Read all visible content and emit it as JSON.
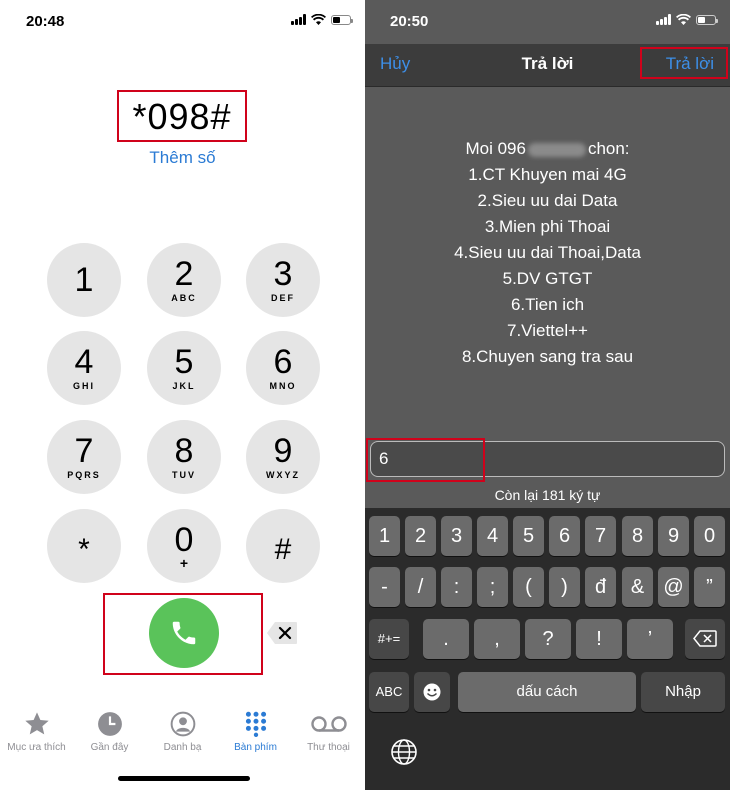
{
  "left": {
    "status_time": "20:48",
    "number": "*098#",
    "add_number": "Thêm số",
    "keys": [
      {
        "digit": "1",
        "letters": ""
      },
      {
        "digit": "2",
        "letters": "ABC"
      },
      {
        "digit": "3",
        "letters": "DEF"
      },
      {
        "digit": "4",
        "letters": "GHI"
      },
      {
        "digit": "5",
        "letters": "JKL"
      },
      {
        "digit": "6",
        "letters": "MNO"
      },
      {
        "digit": "7",
        "letters": "PQRS"
      },
      {
        "digit": "8",
        "letters": "TUV"
      },
      {
        "digit": "9",
        "letters": "WXYZ"
      },
      {
        "digit": "*",
        "letters": ""
      },
      {
        "digit": "0",
        "letters": "+"
      },
      {
        "digit": "#",
        "letters": ""
      }
    ],
    "tabs": [
      {
        "label": "Mục ưa thích",
        "icon": "star-icon"
      },
      {
        "label": "Gần đây",
        "icon": "clock-icon"
      },
      {
        "label": "Danh bạ",
        "icon": "contact-icon"
      },
      {
        "label": "Bàn phím",
        "icon": "keypad-icon",
        "active": true
      },
      {
        "label": "Thư thoại",
        "icon": "voicemail-icon"
      }
    ],
    "accent_color": "#2b7bd4",
    "call_color": "#5ac35a"
  },
  "right": {
    "status_time": "20:50",
    "nav": {
      "cancel": "Hủy",
      "title": "Trả lời",
      "reply": "Trả lời"
    },
    "message": {
      "line1_prefix": "Moi 096",
      "line1_suffix": "chon:",
      "options": [
        "1.CT Khuyen mai 4G",
        "2.Sieu uu dai Data",
        "3.Mien phi Thoai",
        "4.Sieu uu dai Thoai,Data",
        "5.DV GTGT",
        "6.Tien ich",
        "7.Viettel++",
        "8.Chuyen sang tra sau"
      ]
    },
    "input_value": "6",
    "remaining": "Còn lại 181 ký tự",
    "keyboard": {
      "row1": [
        "1",
        "2",
        "3",
        "4",
        "5",
        "6",
        "7",
        "8",
        "9",
        "0"
      ],
      "row2": [
        "-",
        "/",
        ":",
        ";",
        "(",
        ")",
        "đ",
        "&",
        "@",
        "”"
      ],
      "row3": [
        ".",
        ",",
        "?",
        "!",
        "’"
      ],
      "symbols_key": "#+=",
      "abc_key": "ABC",
      "space_key": "dấu cách",
      "return_key": "Nhập"
    },
    "accent_color": "#3d8fe8"
  },
  "highlight_color": "#d0021b"
}
